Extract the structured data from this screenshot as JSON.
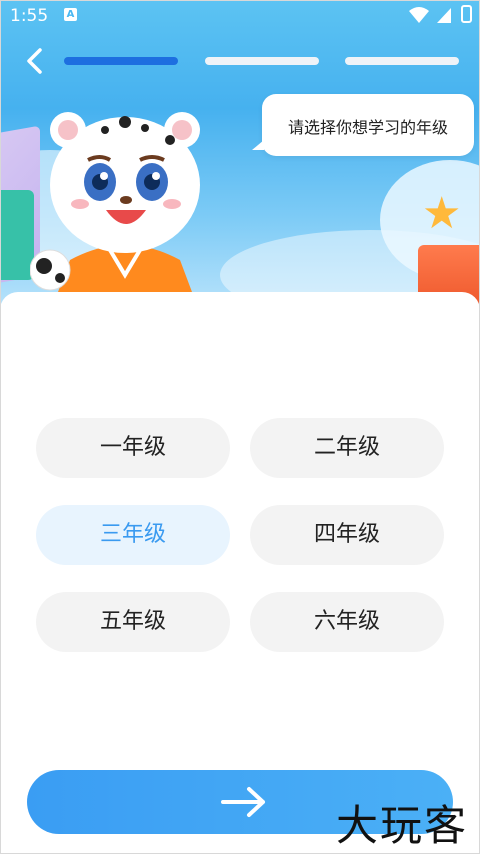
{
  "status_bar": {
    "time": "1:55",
    "notification_badge": "A"
  },
  "progress": {
    "steps": 3,
    "current_step": 1
  },
  "prompt": {
    "text": "请选择你想学习的年级"
  },
  "grades": [
    {
      "label": "一年级",
      "selected": false
    },
    {
      "label": "二年级",
      "selected": false
    },
    {
      "label": "三年级",
      "selected": true
    },
    {
      "label": "四年级",
      "selected": false
    },
    {
      "label": "五年级",
      "selected": false
    },
    {
      "label": "六年级",
      "selected": false
    }
  ],
  "next_button": {
    "icon": "arrow-right-icon"
  },
  "watermark": {
    "text": "大玩客"
  },
  "colors": {
    "accent": "#3a9df3",
    "progress_active": "#1d6fe0",
    "selected_bg": "#e8f4fe",
    "selected_text": "#3a9af0",
    "option_bg": "#f3f3f3"
  }
}
